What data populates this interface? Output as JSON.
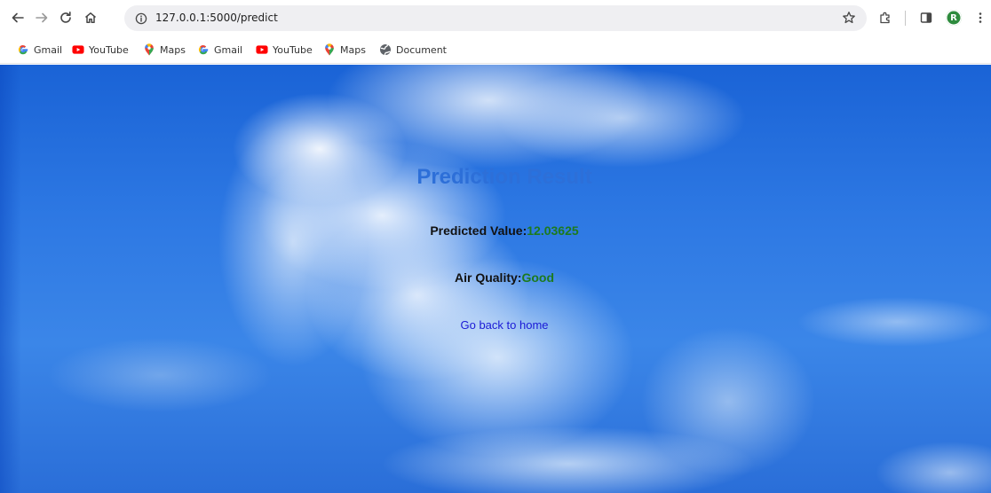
{
  "browser": {
    "url": "127.0.0.1:5000/predict",
    "avatar_initial": "R",
    "accent_color": "#2e8b3d"
  },
  "bookmarks": [
    {
      "label": "Gmail",
      "icon": "google-icon"
    },
    {
      "label": "YouTube",
      "icon": "youtube-icon"
    },
    {
      "label": "Maps",
      "icon": "maps-icon"
    },
    {
      "label": "Gmail",
      "icon": "google-icon"
    },
    {
      "label": "YouTube",
      "icon": "youtube-icon"
    },
    {
      "label": "Maps",
      "icon": "maps-icon"
    },
    {
      "label": "Document",
      "icon": "globe-icon"
    }
  ],
  "page": {
    "title": "Prediction Result",
    "predicted_label": "Predicted Value:",
    "predicted_value": "12.03625",
    "air_quality_label": "Air Quality:",
    "air_quality_value": "Good",
    "home_link": "Go back to home",
    "colors": {
      "title": "#2d6fd8",
      "value": "#1d7a1d",
      "link": "#1a1ad6"
    }
  }
}
